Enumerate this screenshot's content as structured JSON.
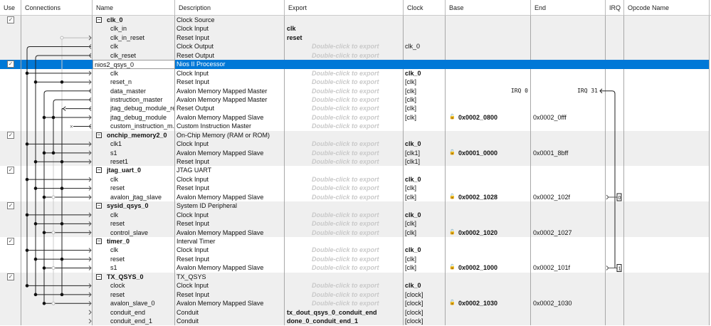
{
  "columns": [
    "Use",
    "Connections",
    "Name",
    "Description",
    "Export",
    "Clock",
    "Base",
    "End",
    "IRQ",
    "Opcode Name"
  ],
  "rows": [
    {
      "t": "g",
      "name": "clk_0",
      "desc": "Clock Source",
      "use": true
    },
    {
      "name": "clk_in",
      "desc": "Clock Input",
      "export": "clk",
      "eb": true
    },
    {
      "name": "clk_in_reset",
      "desc": "Reset Input",
      "export": "reset",
      "eb": true
    },
    {
      "name": "clk",
      "desc": "Clock Output",
      "export": "Double-click to export",
      "clock": "clk_0"
    },
    {
      "name": "clk_reset",
      "desc": "Reset Output",
      "export": "Double-click to export"
    },
    {
      "t": "g",
      "name": "nios2_qsys_0",
      "desc": "Nios II Processor",
      "use": true,
      "sel": true
    },
    {
      "name": "clk",
      "desc": "Clock Input",
      "export": "Double-click to export",
      "clock": "clk_0",
      "cb": true
    },
    {
      "name": "reset_n",
      "desc": "Reset Input",
      "export": "Double-click to export",
      "clock": "[clk]"
    },
    {
      "name": "data_master",
      "desc": "Avalon Memory Mapped Master",
      "export": "Double-click to export",
      "clock": "[clk]",
      "irq_base": "IRQ 0",
      "irq_end": "IRQ 31"
    },
    {
      "name": "instruction_master",
      "desc": "Avalon Memory Mapped Master",
      "export": "Double-click to export",
      "clock": "[clk]"
    },
    {
      "name": "jtag_debug_module_re...",
      "desc": "Reset Output",
      "export": "Double-click to export",
      "clock": "[clk]"
    },
    {
      "name": "jtag_debug_module",
      "desc": "Avalon Memory Mapped Slave",
      "export": "Double-click to export",
      "clock": "[clk]",
      "base": "0x0002_0800",
      "end": "0x0002_0fff"
    },
    {
      "name": "custom_instruction_m...",
      "desc": "Custom Instruction Master",
      "export": "Double-click to export"
    },
    {
      "t": "g",
      "name": "onchip_memory2_0",
      "desc": "On-Chip Memory (RAM or ROM)",
      "use": true
    },
    {
      "name": "clk1",
      "desc": "Clock Input",
      "export": "Double-click to export",
      "clock": "clk_0",
      "cb": true
    },
    {
      "name": "s1",
      "desc": "Avalon Memory Mapped Slave",
      "export": "Double-click to export",
      "clock": "[clk1]",
      "base": "0x0001_0000",
      "end": "0x0001_8bff"
    },
    {
      "name": "reset1",
      "desc": "Reset Input",
      "export": "Double-click to export",
      "clock": "[clk1]"
    },
    {
      "t": "g",
      "name": "jtag_uart_0",
      "desc": "JTAG UART",
      "use": true
    },
    {
      "name": "clk",
      "desc": "Clock Input",
      "export": "Double-click to export",
      "clock": "clk_0",
      "cb": true
    },
    {
      "name": "reset",
      "desc": "Reset Input",
      "export": "Double-click to export",
      "clock": "[clk]"
    },
    {
      "name": "avalon_jtag_slave",
      "desc": "Avalon Memory Mapped Slave",
      "export": "Double-click to export",
      "clock": "[clk]",
      "base": "0x0002_1028",
      "end": "0x0002_102f",
      "irq": "0"
    },
    {
      "t": "g",
      "name": "sysid_qsys_0",
      "desc": "System ID Peripheral",
      "use": true
    },
    {
      "name": "clk",
      "desc": "Clock Input",
      "export": "Double-click to export",
      "clock": "clk_0",
      "cb": true
    },
    {
      "name": "reset",
      "desc": "Reset Input",
      "export": "Double-click to export",
      "clock": "[clk]"
    },
    {
      "name": "control_slave",
      "desc": "Avalon Memory Mapped Slave",
      "export": "Double-click to export",
      "clock": "[clk]",
      "base": "0x0002_1020",
      "end": "0x0002_1027"
    },
    {
      "t": "g",
      "name": "timer_0",
      "desc": "Interval Timer",
      "use": true
    },
    {
      "name": "clk",
      "desc": "Clock Input",
      "export": "Double-click to export",
      "clock": "clk_0",
      "cb": true
    },
    {
      "name": "reset",
      "desc": "Reset Input",
      "export": "Double-click to export",
      "clock": "[clk]"
    },
    {
      "name": "s1",
      "desc": "Avalon Memory Mapped Slave",
      "export": "Double-click to export",
      "clock": "[clk]",
      "base": "0x0002_1000",
      "end": "0x0002_101f",
      "irq": "1"
    },
    {
      "t": "g",
      "name": "TX_QSYS_0",
      "desc": "TX_QSYS",
      "use": true
    },
    {
      "name": "clock",
      "desc": "Clock Input",
      "export": "Double-click to export",
      "clock": "clk_0",
      "cb": true
    },
    {
      "name": "reset",
      "desc": "Reset Input",
      "export": "Double-click to export",
      "clock": "[clock]"
    },
    {
      "name": "avalon_slave_0",
      "desc": "Avalon Memory Mapped Slave",
      "export": "Double-click to export",
      "clock": "[clock]",
      "base": "0x0002_1030",
      "end": "0x0002_1030"
    },
    {
      "name": "conduit_end",
      "desc": "Conduit",
      "export": "tx_dout_qsys_0_conduit_end",
      "eb": true,
      "clock": "[clock]"
    },
    {
      "name": "conduit_end_1",
      "desc": "Conduit",
      "export": "done_0_conduit_end_1",
      "eb": true,
      "clock": "[clock]"
    }
  ],
  "colors": {
    "selection": "#0078d7",
    "group_alt": "#efefef"
  }
}
